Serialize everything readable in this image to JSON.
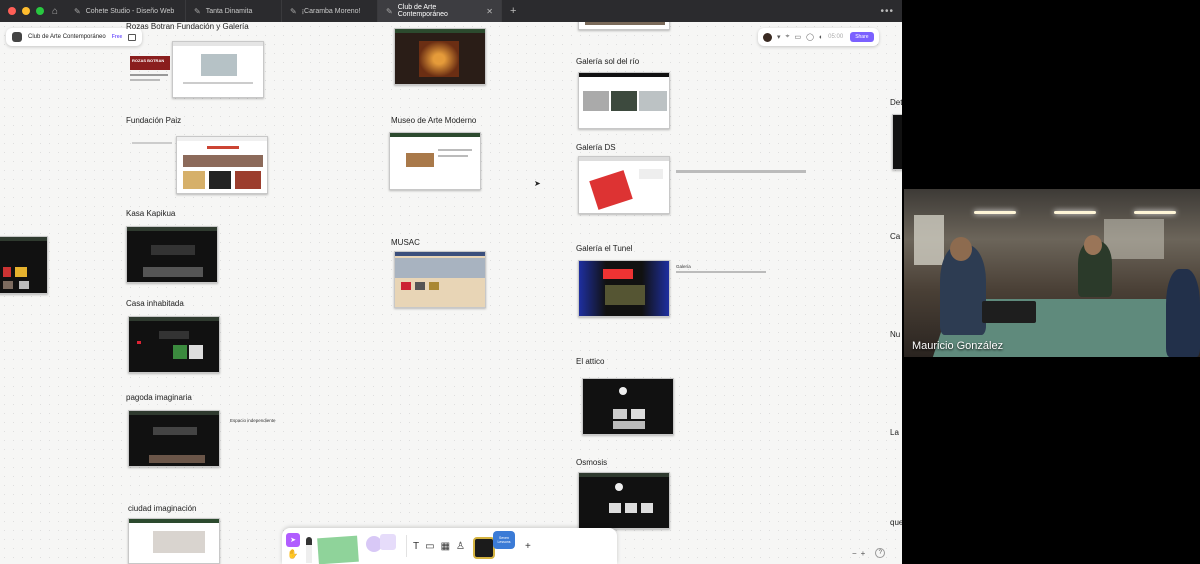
{
  "browser": {
    "tabs": [
      {
        "label": "Cohete Studio - Diseño Web",
        "active": false
      },
      {
        "label": "Tanta Dinamita",
        "active": false
      },
      {
        "label": "¡Caramba Moreno!",
        "active": false
      },
      {
        "label": "Club de Arte Contemporáneo",
        "active": true
      }
    ],
    "new_tab": "+",
    "more": "•••"
  },
  "file": {
    "name": "Club de Arte Contemporáneo",
    "plan": "Free"
  },
  "topbar": {
    "timer": "05:00",
    "share": "Share"
  },
  "canvas": {
    "labels": {
      "roza": "Rozas Botran Fundación y Galería",
      "paiz": "Fundación Paiz",
      "kapikua": "Kasa Kapikua",
      "habitada": "Casa inhabitada",
      "pagoda": "pagoda imaginaria",
      "ciudad": "ciudad imaginación",
      "museo": "Museo de Arte Moderno",
      "musac": "MUSAC",
      "sol": "Galería sol del río",
      "ds": "Galería DS",
      "tunel": "Galería el Tunel",
      "attico": "El attico",
      "osmosis": "Osmosis",
      "det": "Det",
      "ca": "Ca",
      "nu": "Nu",
      "la": "La",
      "que": "que"
    },
    "notes": {
      "pagoda": "Espacio independiente",
      "tunel": "Galería"
    },
    "thumb_text": {
      "rozas_logo": "ROZAS BOTRAN"
    }
  },
  "toolbar": {
    "text_tool": "T",
    "add": "+",
    "sticker_text": "Seven Lessons"
  },
  "zoom": {
    "minus": "−",
    "plus": "+",
    "help": "?"
  },
  "video": {
    "participant": "Mauricio González"
  },
  "colors": {
    "accent": "#7b61ff",
    "select_tool": "#b05cff",
    "traffic_red": "#ff5f57",
    "traffic_yellow": "#febc2e",
    "traffic_green": "#28c840"
  }
}
